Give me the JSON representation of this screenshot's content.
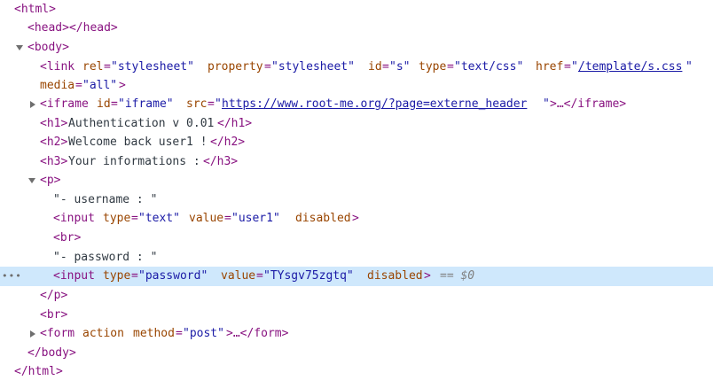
{
  "lines": {
    "html_open": "<html>",
    "head": "<head></head>",
    "body_open": "<body>",
    "link_open": "<link",
    "link_rel_name": "rel",
    "link_rel_val": "\"stylesheet\"",
    "link_prop_name": "property",
    "link_prop_val": "\"stylesheet\"",
    "link_id_name": "id",
    "link_id_val": "\"s\"",
    "link_type_name": "type",
    "link_type_val": "\"text/css\"",
    "link_href_name": "href",
    "link_href_val": "/template/s.css",
    "link_media_name": "media",
    "link_media_val": "\"all\"",
    "iframe_open": "<iframe",
    "iframe_id_name": "id",
    "iframe_id_val": "\"iframe\"",
    "iframe_src_name": "src",
    "iframe_src_val": "https://www.root-me.org/?page=externe_header",
    "iframe_close": ">…</iframe>",
    "h1": "<h1>",
    "h1_text": "Authentication v 0.01",
    "h1_close": "</h1>",
    "h2": "<h2>",
    "h2_text": "Welcome back user1 !",
    "h2_close": "</h2>",
    "h3": "<h3>",
    "h3_text": "Your informations :",
    "h3_close": "</h3>",
    "p_open": "<p>",
    "username_text": "\"- username : \"",
    "input1_open": "<input",
    "input1_type_name": "type",
    "input1_type_val": "\"text\"",
    "input1_value_name": "value",
    "input1_value_val": "\"user1\"",
    "input1_disabled": "disabled",
    "br1": "<br>",
    "password_text": "\"- password : \"",
    "input2_open": "<input",
    "input2_type_name": "type",
    "input2_type_val": "\"password\"",
    "input2_value_name": "value",
    "input2_value_val": "\"TYsgv75zgtq\"",
    "input2_disabled": "disabled",
    "input2_ref": "== $0",
    "p_close": "</p>",
    "br2": "<br>",
    "form_open": "<form",
    "form_action_name": "action",
    "form_method_name": "method",
    "form_method_val": "\"post\"",
    "form_close": ">…</form>",
    "body_close": "</body>",
    "html_close": "</html>"
  },
  "icons": {
    "expand": "triangle-down-icon",
    "collapsed": "triangle-right-icon",
    "more": "ellipsis-icon"
  },
  "colors": {
    "tag": "#881280",
    "attr_name": "#994500",
    "attr_value": "#1a1aa6",
    "selection": "#cfe8fc"
  }
}
